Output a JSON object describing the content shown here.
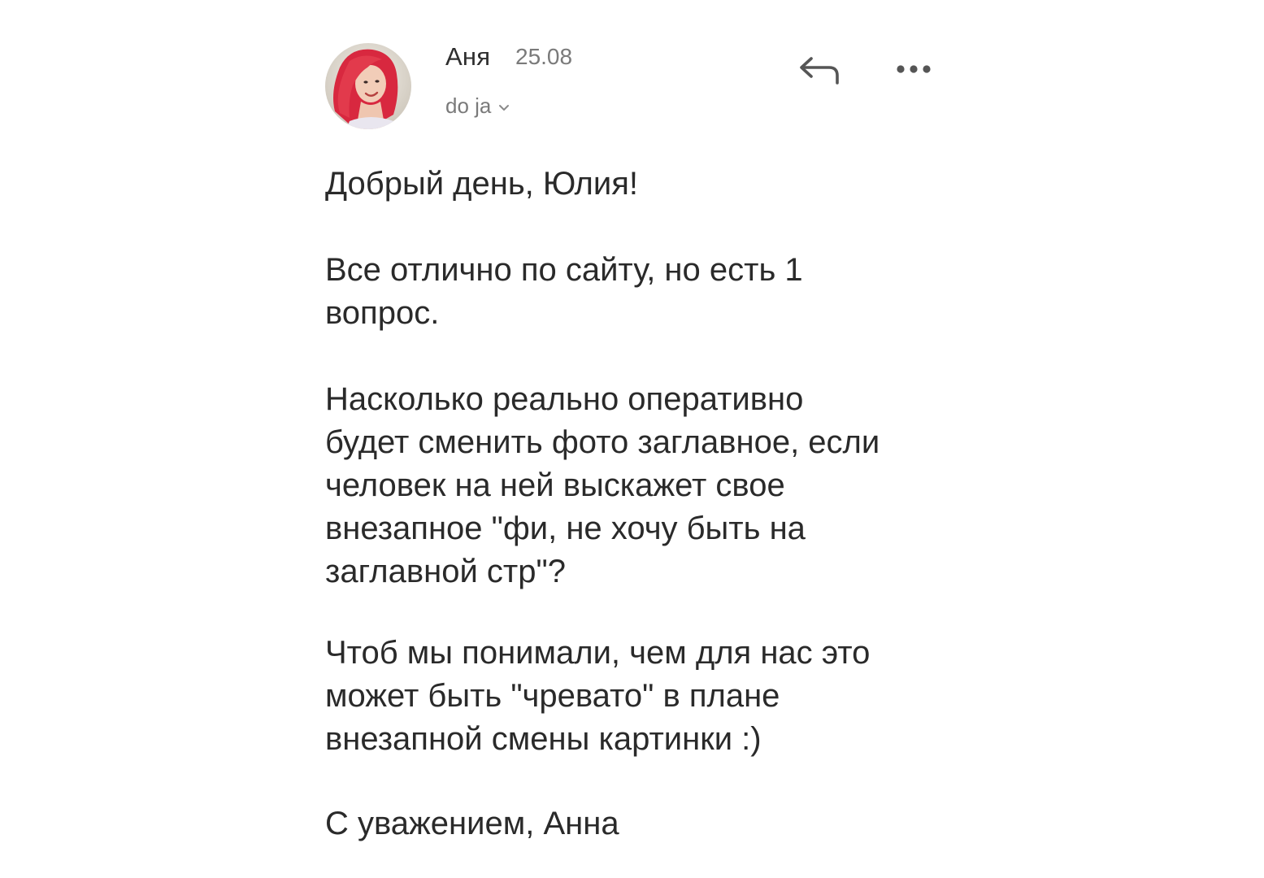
{
  "message": {
    "sender": {
      "name": "Аня",
      "date": "25.08",
      "recipient": "do ja",
      "avatar_icon": "user-photo-avatar"
    },
    "actions": {
      "reply_icon": "reply-arrow-icon",
      "more_icon": "more-dots-icon"
    },
    "body": {
      "greeting": "Добрый день, Юлия!",
      "paragraph1": "Все отлично по сайту, но есть 1\nвопрос.",
      "paragraph2": "Насколько реально оперативно\nбудет сменить фото заглавное, если\nчеловек на ней выскажет свое\nвнезапное \"фи, не хочу быть на\nзаглавной стр\"?",
      "paragraph3": "Чтоб мы понимали, чем для нас это\nможет быть \"чревато\" в плане\nвнезапной смены картинки :)",
      "signature": "С уважением, Анна"
    },
    "colors": {
      "text": "#2a2a2a",
      "secondary_text": "#7a7a7a",
      "icon": "#555555",
      "avatar_hair": "#e23a4c",
      "background": "#ffffff"
    }
  }
}
